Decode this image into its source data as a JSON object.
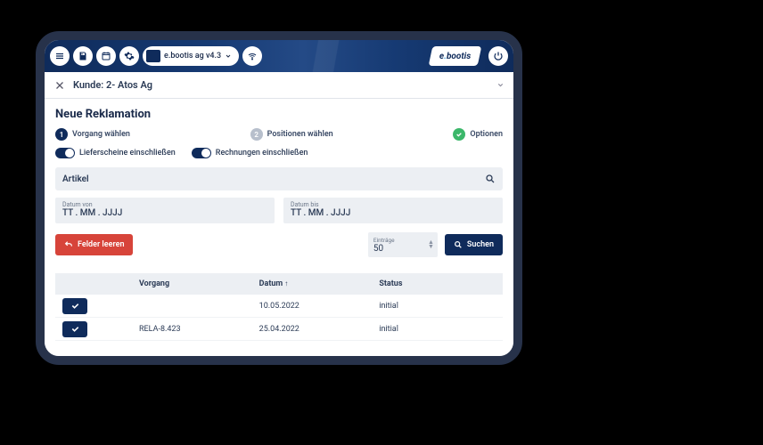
{
  "topbar": {
    "tenant_label": "e.bootis ag v4.3",
    "logo_prefix": "e",
    "logo_suffix": "bootis"
  },
  "subheader": {
    "title": "Kunde: 2- Atos Ag"
  },
  "page": {
    "title": "Neue Reklamation"
  },
  "stepper": {
    "step1_num": "1",
    "step1_label": "Vorgang wählen",
    "step2_num": "2",
    "step2_label": "Positionen wählen",
    "step3_label": "Optionen"
  },
  "toggles": {
    "delivery": "Lieferscheine einschließen",
    "invoices": "Rechnungen einschließen"
  },
  "search": {
    "article_label": "Artikel"
  },
  "dates": {
    "from_label": "Datum von",
    "from_placeholder": "TT . MM . JJJJ",
    "to_label": "Datum bis",
    "to_placeholder": "TT . MM . JJJJ"
  },
  "entries": {
    "label": "Einträge",
    "value": "50"
  },
  "buttons": {
    "clear": "Felder leeren",
    "search": "Suchen"
  },
  "table": {
    "col_vorgang": "Vorgang",
    "col_datum": "Datum",
    "sort_indicator": "↑",
    "col_status": "Status",
    "rows": [
      {
        "vorgang": "",
        "datum": "10.05.2022",
        "status": "initial"
      },
      {
        "vorgang": "RELA-8.423",
        "datum": "25.04.2022",
        "status": "initial"
      }
    ]
  }
}
